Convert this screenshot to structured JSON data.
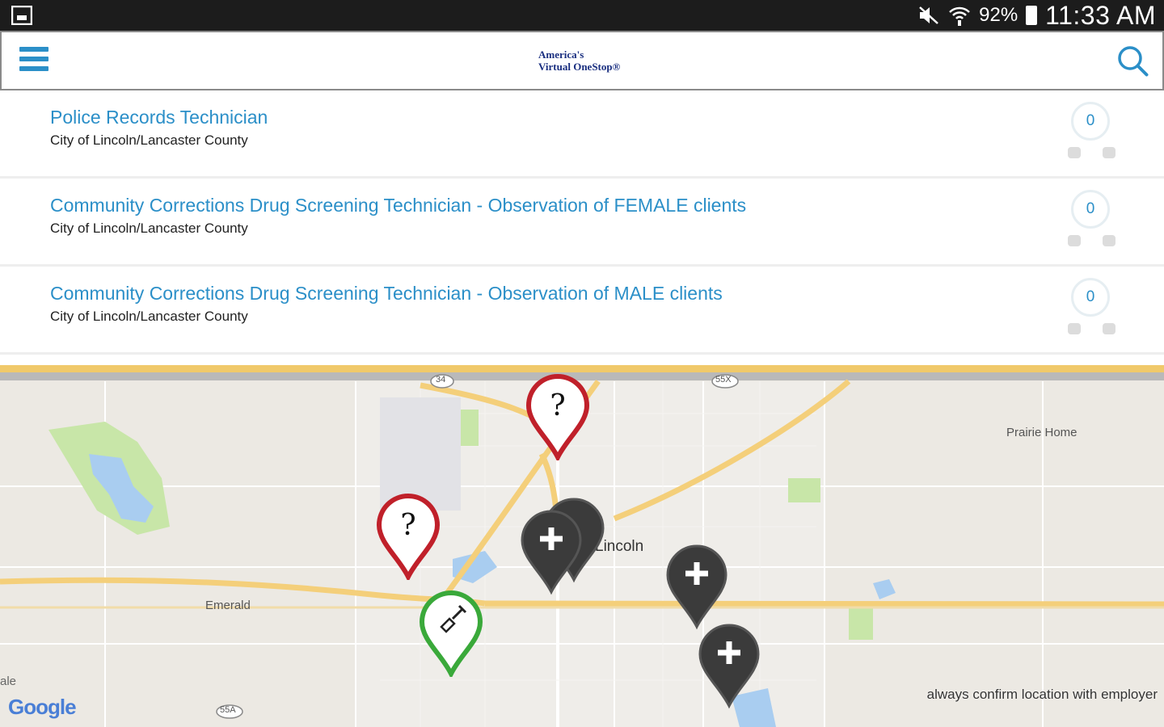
{
  "status_bar": {
    "battery": "92%",
    "time": "11:33 AM"
  },
  "app_bar": {
    "logo_line1": "America's",
    "logo_line2": "Virtual OneStop",
    "logo_mark": "®"
  },
  "jobs": [
    {
      "title": "Police Records Technician",
      "employer": "City of Lincoln/Lancaster County",
      "count": "0"
    },
    {
      "title": "Community Corrections Drug Screening Technician - Observation of FEMALE clients",
      "employer": "City of Lincoln/Lancaster County",
      "count": "0"
    },
    {
      "title": "Community Corrections Drug Screening Technician - Observation of MALE clients",
      "employer": "City of Lincoln/Lancaster County",
      "count": "0"
    }
  ],
  "map": {
    "places": {
      "prairie_home": "Prairie Home",
      "lincoln": "Lincoln",
      "emerald": "Emerald",
      "edge": "ale"
    },
    "route_shields": [
      "34",
      "55X",
      "55A"
    ],
    "note": "always confirm location with employer",
    "google": "Google",
    "colors": {
      "question_pin": "#c0202a",
      "plus_pin": "#3b3b3b",
      "shovel_pin": "#3aa93a",
      "road": "#f4cf7a",
      "water": "#a9cdf0",
      "park": "#c8e6a8"
    }
  }
}
